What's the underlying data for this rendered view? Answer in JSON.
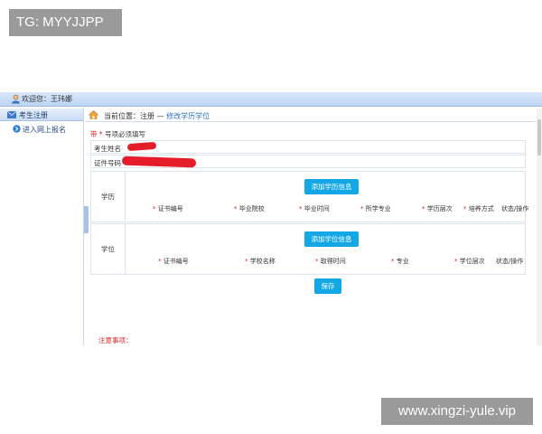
{
  "overlay": {
    "tg_label": "TG: MYYJJPP",
    "url_label": "www.xingzi-yule.vip"
  },
  "topbar": {
    "welcome": "欢迎您：王玮娜"
  },
  "sidebar": {
    "title": "考生注册",
    "items": [
      {
        "label": "进入网上报名"
      }
    ]
  },
  "breadcrumb": {
    "prefix": "当前位置：注册 — ",
    "current": "修改学历学位"
  },
  "form": {
    "required_note_star": "带 * ",
    "required_note_text": "号项必须填写",
    "name_label": "考生姓名",
    "id_label": "证件号码",
    "education": {
      "label": "学历",
      "add_button": "添加学历信息",
      "columns": [
        {
          "label": "证书编号",
          "required": true
        },
        {
          "label": "毕业院校",
          "required": true
        },
        {
          "label": "毕业时间",
          "required": true
        },
        {
          "label": "所学专业",
          "required": true
        },
        {
          "label": "学历层次",
          "required": true
        },
        {
          "label": "培养方式",
          "required": true
        },
        {
          "label": "状态/操作",
          "required": false
        }
      ]
    },
    "degree": {
      "label": "学位",
      "add_button": "添加学位信息",
      "columns": [
        {
          "label": "证书编号",
          "required": true
        },
        {
          "label": "学校名称",
          "required": true
        },
        {
          "label": "取得时间",
          "required": true
        },
        {
          "label": "专业",
          "required": true
        },
        {
          "label": "学位层次",
          "required": true
        },
        {
          "label": "状态/操作",
          "required": false
        }
      ]
    },
    "save_button": "保存",
    "notice_title": "注意事项："
  },
  "colors": {
    "accent_button": "#14a7e6",
    "required_star": "#e02020",
    "redaction": "#e51d2a"
  }
}
